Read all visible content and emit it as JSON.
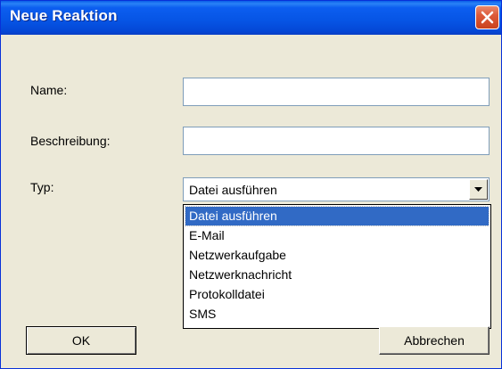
{
  "window": {
    "title": "Neue Reaktion",
    "close_icon": "close-icon"
  },
  "form": {
    "name_label": "Name:",
    "name_value": "",
    "description_label": "Beschreibung:",
    "description_value": "",
    "type_label": "Typ:",
    "type_selected": "Datei ausführen",
    "type_options": [
      "Datei ausführen",
      "E-Mail",
      "Netzwerkaufgabe",
      "Netzwerknachricht",
      "Protokolldatei",
      "SMS"
    ]
  },
  "buttons": {
    "ok_label": "OK",
    "cancel_label": "Abbrechen"
  }
}
